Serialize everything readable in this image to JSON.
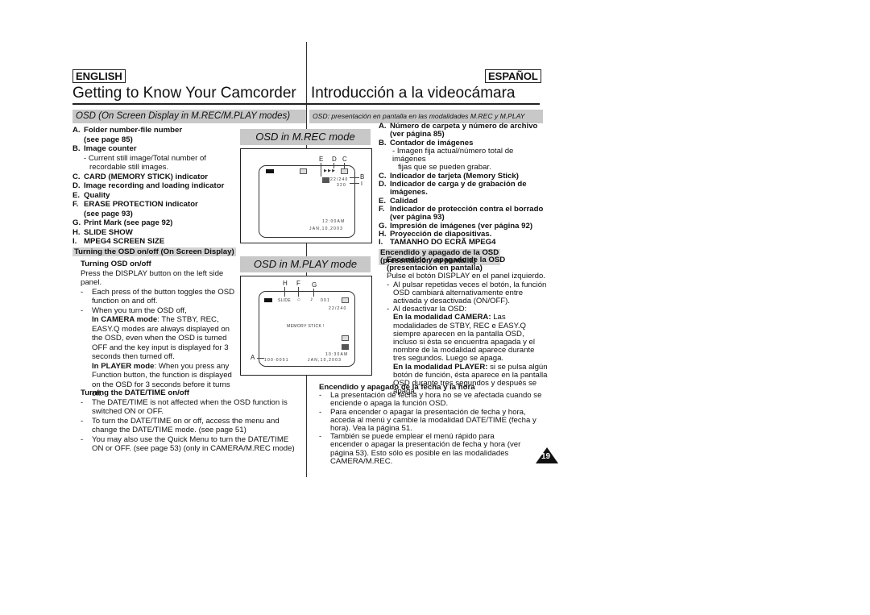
{
  "header": {
    "lang_en": "ENGLISH",
    "lang_es": "ESPAÑOL",
    "title_en": "Getting to Know Your Camcorder",
    "title_es": "Introducción a la videocámara"
  },
  "section": {
    "heading_en": "OSD (On Screen Display in M.REC/M.PLAY modes)",
    "heading_es": "OSD: presentación en pantalla en las modalidades M.REC y M.PLAY"
  },
  "english": {
    "items": [
      {
        "key": "A.",
        "text": "Folder number-file number"
      },
      {
        "key": "",
        "text": "(see page 85)"
      },
      {
        "key": "B.",
        "text": "Image counter"
      },
      {
        "key": "C.",
        "text": "CARD (MEMORY STICK) indicator"
      },
      {
        "key": "D.",
        "text": "Image recording and loading indicator"
      },
      {
        "key": "E.",
        "text": "Quality"
      },
      {
        "key": "F.",
        "text": "ERASE PROTECTION indicator"
      },
      {
        "key": "",
        "text": "(see page 93)"
      },
      {
        "key": "G.",
        "text": "Print Mark (see page 92)"
      },
      {
        "key": "H.",
        "text": "SLIDE SHOW"
      },
      {
        "key": "I.",
        "text": "MPEG4 SCREEN SIZE"
      }
    ],
    "image_counter_sub1": "- Current still image/Total number of",
    "image_counter_sub2": "recordable still images.",
    "osd_onoff_heading": "Turning the OSD on/off (On Screen Display)",
    "turning_osd_title": "Turning OSD on/off",
    "press_display": "Press the DISPLAY button on the left side panel.",
    "bullet1": "Each press of the button toggles the OSD function on and off.",
    "bullet2": "When you turn the OSD off,",
    "camera_mode_label": "In CAMERA mode",
    "camera_mode_text": ": The STBY, REC, EASY.Q modes are always displayed on the OSD, even when the OSD is turned OFF and the key input is displayed for 3 seconds then turned off.",
    "player_mode_label": "In PLAYER mode",
    "player_mode_text": ": When you press any Function button, the function is displayed on the OSD for 3 seconds before it turns off.",
    "datetime_title": "Turning the DATE/TIME on/off",
    "datetime_bullets": [
      "The DATE/TIME is not affected when the OSD function is switched ON or OFF.",
      "To turn the DATE/TIME on or off, access the menu and change the DATE/TIME mode. (see page 51)",
      "You may also use the Quick Menu to turn the DATE/TIME ON or OFF. (see page 53) (only in CAMERA/M.REC mode)"
    ]
  },
  "osd_rec": {
    "heading": "OSD in M.REC mode",
    "labels": {
      "e": "E",
      "d": "D",
      "c": "C",
      "b": "B",
      "i": "I"
    },
    "counter": "22/240",
    "size": "320",
    "time": "12:00AM",
    "date": "JAN,10,2003"
  },
  "osd_play": {
    "heading": "OSD in M.PLAY mode",
    "labels": {
      "h": "H",
      "f": "F",
      "g": "G",
      "a": "A"
    },
    "slide": "SLIDE",
    "print_count": "001",
    "counter": "22/240",
    "message": "MEMORY STICK !",
    "time": "10:30AM",
    "date": "JAN,10,2003",
    "file_number": "100-0001"
  },
  "spanish": {
    "items": [
      {
        "key": "A.",
        "text": "Número de carpeta y número de archivo"
      },
      {
        "key": "",
        "text": "(ver página 85)"
      },
      {
        "key": "B.",
        "text": "Contador de imágenes"
      },
      {
        "key": "C.",
        "text": "Indicador de tarjeta (Memory Stick)"
      },
      {
        "key": "D.",
        "text": "Indicador de carga y de grabación de"
      },
      {
        "key": "",
        "text": "imágenes."
      },
      {
        "key": "E.",
        "text": "Calidad"
      },
      {
        "key": "F.",
        "text": "Indicador de protección contra el borrado"
      },
      {
        "key": "",
        "text": "(ver página 93)"
      },
      {
        "key": "G.",
        "text": "Impresión de imágenes (ver página 92)"
      },
      {
        "key": "H.",
        "text": "Proyección de diapositivas."
      },
      {
        "key": "I.",
        "text": "TAMANHO DO ECRÃ MPEG4"
      }
    ],
    "image_counter_sub1": "- Imagen fija actual/número total de imágenes",
    "image_counter_sub2": "fijas que se pueden grabar.",
    "osd_onoff_heading_1": "Encendido y apagado de la OSD",
    "osd_onoff_heading_2": "(presentación en pantalla)",
    "sub_title_1": "Encendido y apagado de la OSD",
    "sub_title_2": "(presentación en pantalla)",
    "press_display": "Pulse el botón DISPLAY en el panel izquierdo.",
    "bullet1": "Al pulsar repetidas veces el botón, la función OSD cambiará alternativamente entre activada y desactivada (ON/OFF).",
    "bullet2": "Al desactivar la OSD:",
    "camera_mode_label": "En la modalidad CAMERA:",
    "camera_mode_text": " Las modalidades de STBY, REC e EASY.Q siempre aparecen en la pantalla OSD, incluso si ésta se encuentra apagada y el nombre de la modalidad aparece durante tres segundos. Luego se apaga.",
    "player_mode_label": "En la modalidad PLAYER:",
    "player_mode_text": " si se pulsa algún botón de función, ésta aparece en la pantalla OSD durante tres segundos y después se apaga.",
    "datetime_title": "Encendido y apagado de la fecha y la hora",
    "datetime_bullets": [
      "La presentación de fecha y hora no se ve afectada cuando se enciende o apaga la función OSD.",
      "Para encender o apagar la presentación de fecha y hora, acceda al menú y cambie la modalidad DATE/TIME (fecha y hora). Vea la página 51.",
      "También se puede emplear el menú rápido para encender o apagar la presentación de fecha y hora (ver página 53). Esto sólo es posible en las modalidades CAMERA/M.REC."
    ]
  },
  "page_number": "19"
}
